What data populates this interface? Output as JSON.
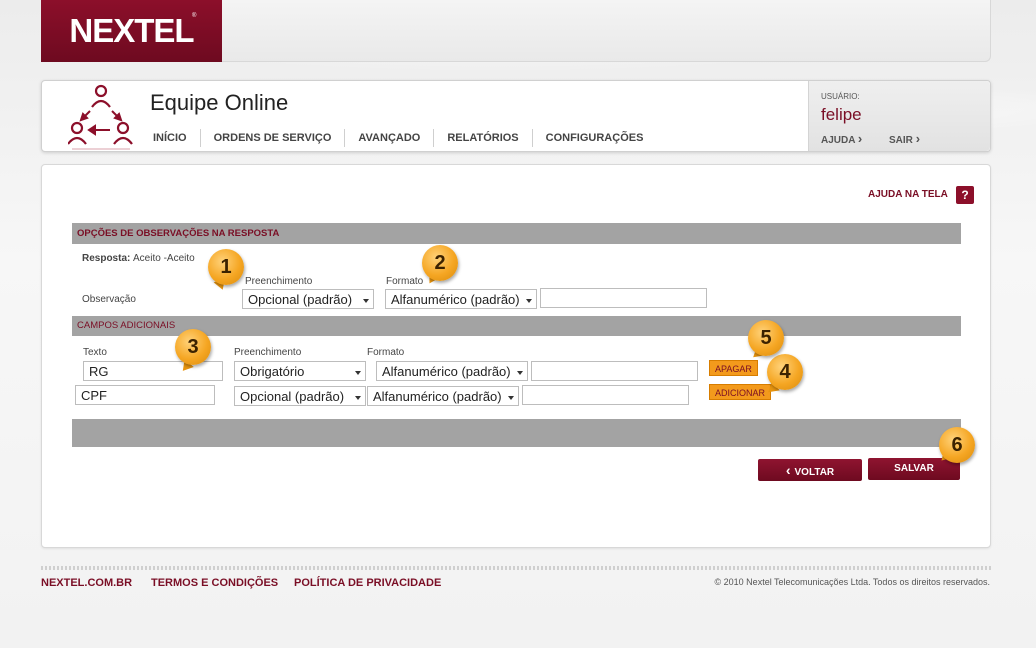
{
  "brand": {
    "logo": "NEXTEL",
    "tm": "®",
    "color": "#8c0f2a"
  },
  "app": {
    "title": "Equipe Online",
    "icon": "team-org-icon",
    "nav": [
      "INÍCIO",
      "ORDENS DE SERVIÇO",
      "AVANÇADO",
      "RELATÓRIOS",
      "CONFIGURAÇÕES"
    ]
  },
  "user": {
    "caption": "USUÁRIO:",
    "name": "felipe",
    "help_label": "AJUDA",
    "logout_label": "SAIR",
    "chevron": "›"
  },
  "help": {
    "label": "AJUDA NA TELA",
    "icon_text": "?"
  },
  "obs_section": {
    "title": "OPÇÕES DE OBSERVAÇÕES NA RESPOSTA",
    "response_label": "Resposta:",
    "response_value": "Aceito -Aceito",
    "fill_label": "Preenchimento",
    "format_label": "Formato",
    "row_label": "Observação",
    "fill_value": "Opcional (padrão)",
    "format_value": "Alfanumérico (padrão)",
    "extra_value": ""
  },
  "fields_section": {
    "title": "CAMPOS ADICIONAIS",
    "text_label": "Texto",
    "fill_label": "Preenchimento",
    "format_label": "Formato",
    "rows": [
      {
        "text": "RG",
        "fill": "Obrigatório",
        "format": "Alfanumérico (padrão)",
        "extra": ""
      },
      {
        "text": "CPF",
        "fill": "Opcional (padrão)",
        "format": "Alfanumérico (padrão)",
        "extra": ""
      }
    ],
    "delete_label": "APAGAR",
    "add_label": "ADICIONAR"
  },
  "badges": [
    "1",
    "2",
    "3",
    "4",
    "5",
    "6"
  ],
  "actions": {
    "back_label": "VOLTAR",
    "back_icon": "‹",
    "save_label": "SALVAR"
  },
  "footer": {
    "links": [
      "NEXTEL.COM.BR",
      "TERMOS E CONDIÇÕES",
      "POLÍTICA DE PRIVACIDADE"
    ],
    "copyright": "© 2010 Nextel Telecomunicações Ltda. Todos os direitos reservados."
  }
}
